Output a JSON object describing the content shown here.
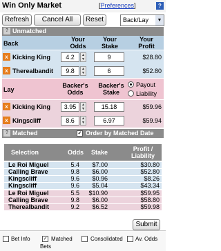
{
  "app": {
    "title": "Win Only Market",
    "preferences_open": "[",
    "preferences_label": "Preferences",
    "preferences_close": "]",
    "help": "?"
  },
  "toolbar": {
    "refresh": "Refresh",
    "cancel_all": "Cancel All",
    "reset": "Reset",
    "view_select": "Back/Lay",
    "select_arrow": "▼"
  },
  "unmatched": {
    "header": "Unmatched",
    "icon": "?",
    "back": {
      "label": "Back",
      "col_odds": [
        "Your",
        "Odds"
      ],
      "col_stake": [
        "Your",
        "Stake"
      ],
      "col_profit": [
        "Your",
        "Profit"
      ],
      "rows": [
        {
          "name": "Kicking King",
          "odds": "4.2",
          "stake": "9",
          "profit": "$28.80"
        },
        {
          "name": "Therealbandit",
          "odds": "9.8",
          "stake": "6",
          "profit": "$52.80"
        }
      ]
    },
    "lay": {
      "label": "Lay",
      "col_odds": [
        "Backer's",
        "Odds"
      ],
      "col_stake": [
        "Backer's",
        "Stake"
      ],
      "radio_payout": "Payout",
      "radio_liability": "Liability",
      "rows": [
        {
          "name": "Kicking King",
          "odds": "3.95",
          "stake": "15.18",
          "profit": "$59.96"
        },
        {
          "name": "Kingscliff",
          "odds": "8.6",
          "stake": "6.97",
          "profit": "$59.94"
        }
      ]
    }
  },
  "matched": {
    "header": "Matched",
    "icon": "?",
    "order_label": "Order by Matched Date",
    "order_checked": true,
    "columns": {
      "selection": "Selection",
      "odds": "Odds",
      "stake": "Stake",
      "profit": [
        "Profit /",
        "Liability"
      ]
    },
    "rows": [
      {
        "type": "back",
        "name": "Le Roi Miguel",
        "odds": "5.4",
        "stake": "$7.00",
        "profit": "$30.80"
      },
      {
        "type": "back",
        "name": "Calling Brave",
        "odds": "9.8",
        "stake": "$6.00",
        "profit": "$52.80"
      },
      {
        "type": "back",
        "name": "Kingscliff",
        "odds": "9.6",
        "stake": "$0.96",
        "profit": "$8.26"
      },
      {
        "type": "back",
        "name": "Kingscliff",
        "odds": "9.6",
        "stake": "$5.04",
        "profit": "$43.34"
      },
      {
        "type": "lay",
        "name": "Le Roi Miguel",
        "odds": "5.5",
        "stake": "$10.90",
        "profit": "$59.95"
      },
      {
        "type": "lay",
        "name": "Calling Brave",
        "odds": "9.8",
        "stake": "$6.00",
        "profit": "$58.80"
      },
      {
        "type": "lay",
        "name": "Therealbandit",
        "odds": "9.2",
        "stake": "$6.52",
        "profit": "$59.98"
      }
    ]
  },
  "submit": "Submit",
  "footer": {
    "bet_info": "Bet Info",
    "matched_bets_line1": "Matched",
    "matched_bets_line2": "Bets",
    "consolidated": "Consolidated",
    "avg_odds": "Av. Odds",
    "matched_checked": true,
    "tick": "✓"
  },
  "colors": {
    "back": "#d5e4f0",
    "lay": "#ecd3dc",
    "header": "#8b8b8b",
    "cancel_icon": "#e67e1e"
  }
}
